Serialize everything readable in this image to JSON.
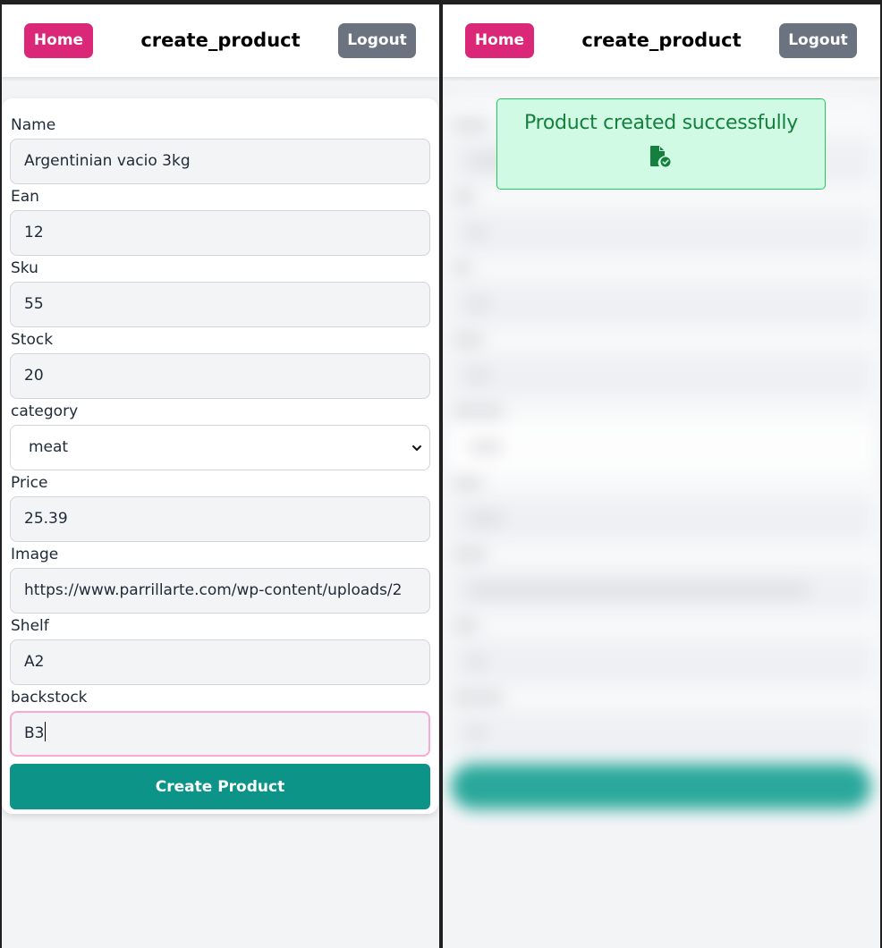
{
  "left_panel": {
    "header": {
      "home_label": "Home",
      "title": "create_product",
      "logout_label": "Logout"
    },
    "form": {
      "fields": [
        {
          "label": "Name",
          "value": "Argentinian vacio 3kg"
        },
        {
          "label": "Ean",
          "value": "12"
        },
        {
          "label": "Sku",
          "value": "55"
        },
        {
          "label": "Stock",
          "value": "20"
        },
        {
          "label": "category",
          "value": "meat",
          "type": "select"
        },
        {
          "label": "Price",
          "value": "25.39"
        },
        {
          "label": "Image",
          "value": "https://www.parrillarte.com/wp-content/uploads/2"
        },
        {
          "label": "Shelf",
          "value": "A2"
        },
        {
          "label": "backstock",
          "value": "B3",
          "focused": true
        }
      ],
      "submit_label": "Create Product"
    }
  },
  "right_panel": {
    "header": {
      "home_label": "Home",
      "title": "create_product",
      "logout_label": "Logout"
    },
    "alert": {
      "message": "Product created successfully",
      "icon": "file-check-icon"
    }
  },
  "colors": {
    "home": "#db2777",
    "logout": "#6b7280",
    "submit": "#0d9488",
    "alert_bg": "#d1fae5",
    "alert_border": "#22c55e",
    "alert_text": "#15803d",
    "focus_border": "#f9a8d4"
  }
}
